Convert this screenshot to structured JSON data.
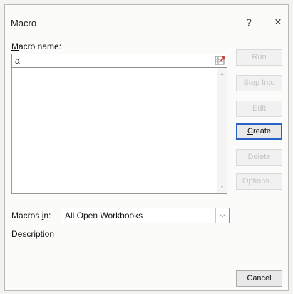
{
  "window": {
    "title": "Macro",
    "help": "?",
    "close": "×"
  },
  "macro_name": {
    "label_underlined": "M",
    "label_rest": "acro name:",
    "value": "a"
  },
  "macro_list": {
    "items": []
  },
  "buttons": {
    "run": "Run",
    "step_into": "Step Into",
    "edit": "Edit",
    "create_underlined": "C",
    "create_rest": "reate",
    "delete": "Delete",
    "options": "Options..."
  },
  "macros_in": {
    "label_rest": "Macros ",
    "label_underlined": "i",
    "label_tail": "n:",
    "selected": "All Open Workbooks"
  },
  "description": {
    "label": "Description",
    "text": ""
  },
  "cancel": "Cancel"
}
